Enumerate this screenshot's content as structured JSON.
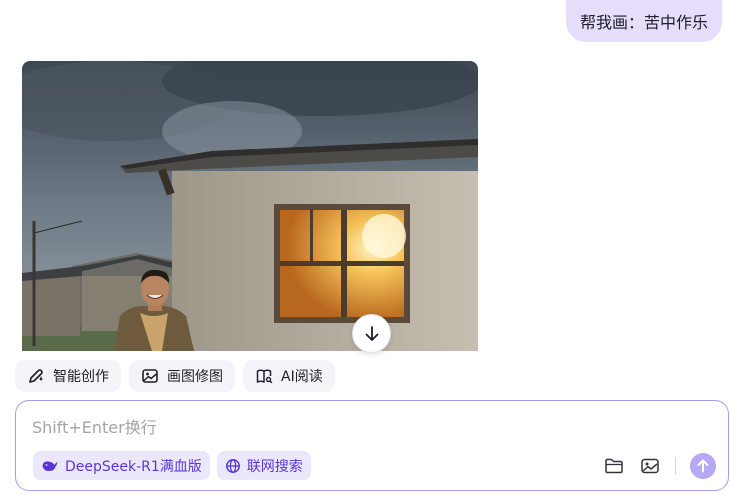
{
  "conversation": {
    "user_message": "帮我画：苦中作乐"
  },
  "quick_actions": [
    {
      "label": "智能创作",
      "icon": "pen-sparkle-icon"
    },
    {
      "label": "画图修图",
      "icon": "image-edit-icon"
    },
    {
      "label": "AI阅读",
      "icon": "book-reader-icon"
    }
  ],
  "composer": {
    "placeholder": "Shift+Enter换行",
    "model_label": "DeepSeek-R1满血版",
    "search_label": "联网搜索"
  },
  "icons": {
    "scroll": "arrow-down-icon",
    "folder": "folder-icon",
    "image": "image-icon",
    "send": "arrow-up-icon"
  },
  "colors": {
    "accent": "#5a34d6",
    "user_bubble": "#e6ddfb",
    "send_button": "#b7a8f4",
    "composer_border": "#a89af0"
  }
}
